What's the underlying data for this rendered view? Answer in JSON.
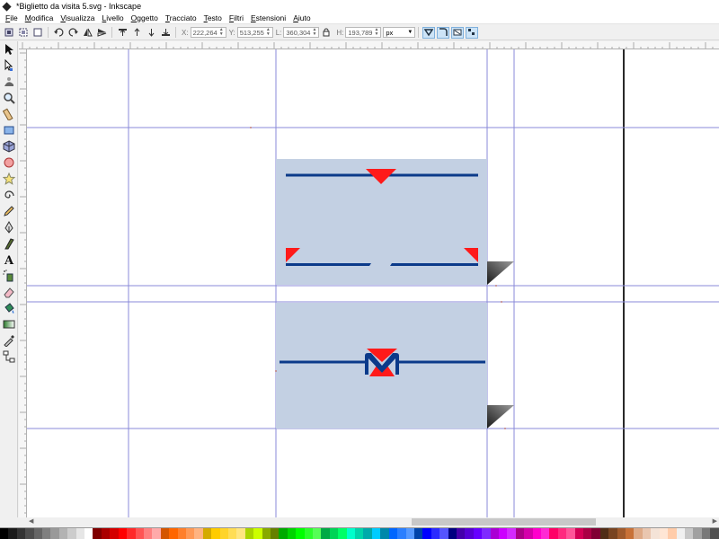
{
  "window": {
    "title": "*Biglietto da visita 5.svg - Inkscape"
  },
  "menubar": {
    "items": [
      "File",
      "Modifica",
      "Visualizza",
      "Livello",
      "Oggetto",
      "Tracciato",
      "Testo",
      "Filtri",
      "Estensioni",
      "Aiuto"
    ]
  },
  "toolbar": {
    "x": {
      "label": "X:",
      "value": "222,264"
    },
    "y": {
      "label": "Y:",
      "value": "513,255"
    },
    "w": {
      "label": "L:",
      "value": "360,304"
    },
    "h": {
      "label": "H:",
      "value": "193,789"
    },
    "unit": "px"
  },
  "tools": [
    "selector",
    "node",
    "tweak",
    "zoom",
    "measure",
    "rectangle",
    "box3d",
    "ellipse",
    "star",
    "spiral",
    "pencil",
    "pen",
    "calligraphy",
    "text",
    "spray",
    "eraser",
    "bucket",
    "gradient",
    "dropper",
    "connector"
  ],
  "canvas": {
    "card_fill": "#c3d0e3",
    "brand_blue": "#0b3a8a",
    "brand_red": "#ff1a1a",
    "guide_color": "#8a8ad8"
  },
  "palette": [
    "#000000",
    "#1a1a1a",
    "#333333",
    "#4d4d4d",
    "#666666",
    "#808080",
    "#999999",
    "#b3b3b3",
    "#cccccc",
    "#e6e6e6",
    "#ffffff",
    "#800000",
    "#aa0000",
    "#d40000",
    "#ff0000",
    "#ff2a2a",
    "#ff5555",
    "#ff8080",
    "#ffaaaa",
    "#d45500",
    "#ff6600",
    "#ff7f2a",
    "#ff9955",
    "#ffb380",
    "#d4aa00",
    "#ffcc00",
    "#ffd42a",
    "#ffdd55",
    "#ffe680",
    "#aad400",
    "#ccff00",
    "#88aa00",
    "#668000",
    "#00aa00",
    "#00d400",
    "#00ff00",
    "#2aff2a",
    "#55ff55",
    "#00aa44",
    "#00d455",
    "#00ff66",
    "#00ffcc",
    "#00d4aa",
    "#00aaaa",
    "#00ccff",
    "#0088aa",
    "#0066ff",
    "#2a7fff",
    "#5599ff",
    "#0044aa",
    "#0000ff",
    "#2a2aff",
    "#5555ff",
    "#000080",
    "#4400aa",
    "#5500d4",
    "#6600ff",
    "#7f2aff",
    "#aa00d4",
    "#cc00ff",
    "#d42aff",
    "#aa0088",
    "#d400aa",
    "#ff00cc",
    "#ff2ad4",
    "#ff0066",
    "#ff2a7f",
    "#ff5599",
    "#d40055",
    "#aa0044",
    "#800033",
    "#502d16",
    "#784421",
    "#a05a2c",
    "#c87137",
    "#deaa87",
    "#e9c6af",
    "#f4e3d7",
    "#ffe6d5",
    "#ffccaa",
    "#f0f0f0",
    "#c8c8c8",
    "#a0a0a0",
    "#787878",
    "#505050"
  ]
}
